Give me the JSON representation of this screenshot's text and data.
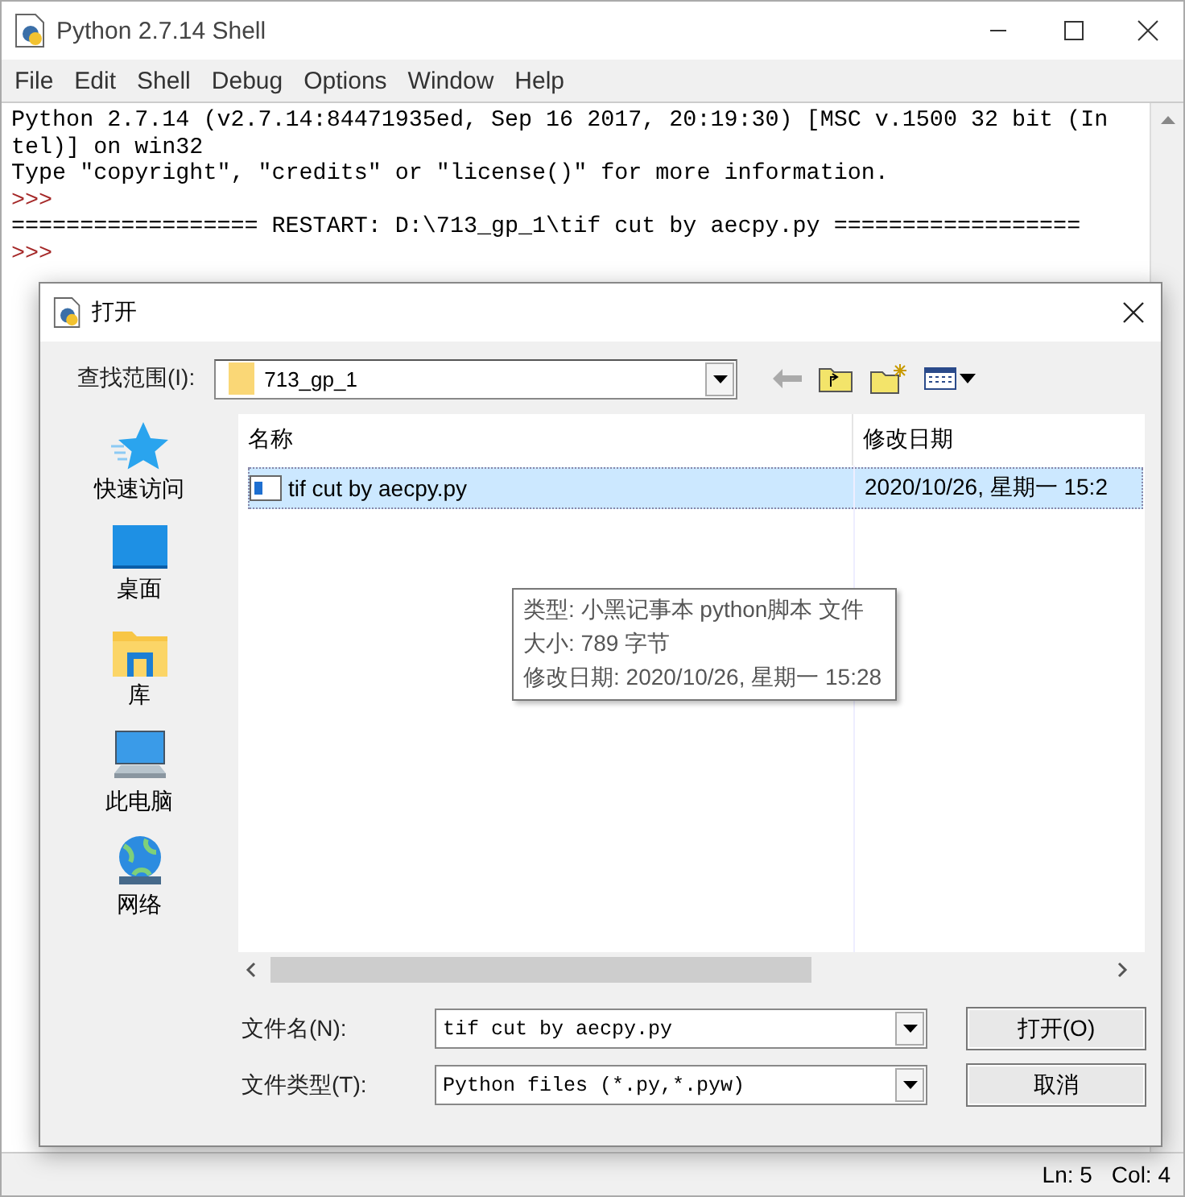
{
  "window": {
    "title": "Python 2.7.14 Shell"
  },
  "menu": [
    "File",
    "Edit",
    "Shell",
    "Debug",
    "Options",
    "Window",
    "Help"
  ],
  "shell": {
    "lines": [
      {
        "kind": "output",
        "text": "Python 2.7.14 (v2.7.14:84471935ed, Sep 16 2017, 20:19:30) [MSC v.1500 32 bit (In"
      },
      {
        "kind": "output",
        "text": "tel)] on win32"
      },
      {
        "kind": "output",
        "text": "Type \"copyright\", \"credits\" or \"license()\" for more information."
      },
      {
        "kind": "prompt",
        "text": ">>>"
      },
      {
        "kind": "output",
        "text": "================== RESTART: D:\\713_gp_1\\tif cut by aecpy.py =================="
      },
      {
        "kind": "prompt",
        "text": ">>>"
      }
    ]
  },
  "dialog": {
    "title": "打开",
    "look_in": {
      "label": "查找范围(I):",
      "value": "713_gp_1"
    },
    "places": [
      {
        "label": "快速访问",
        "kind": "star"
      },
      {
        "label": "桌面",
        "kind": "desktop"
      },
      {
        "label": "库",
        "kind": "library"
      },
      {
        "label": "此电脑",
        "kind": "computer"
      },
      {
        "label": "网络",
        "kind": "network"
      }
    ],
    "columns": [
      "名称",
      "修改日期"
    ],
    "files": [
      {
        "name": "tif cut by aecpy.py",
        "modified": "2020/10/26, 星期一 15:2",
        "selected": true
      }
    ],
    "tooltip": [
      "类型: 小黑记事本 python脚本 文件",
      "大小: 789 字节",
      "修改日期: 2020/10/26, 星期一 15:28"
    ],
    "file_name": {
      "label": "文件名(N):",
      "value": "tif cut by aecpy.py"
    },
    "file_type": {
      "label": "文件类型(T):",
      "value": "Python files (*.py,*.pyw)"
    },
    "buttons": [
      "打开(O)",
      "取消"
    ]
  },
  "status_bar": {
    "line": "Ln: 5",
    "col": "Col: 4"
  }
}
